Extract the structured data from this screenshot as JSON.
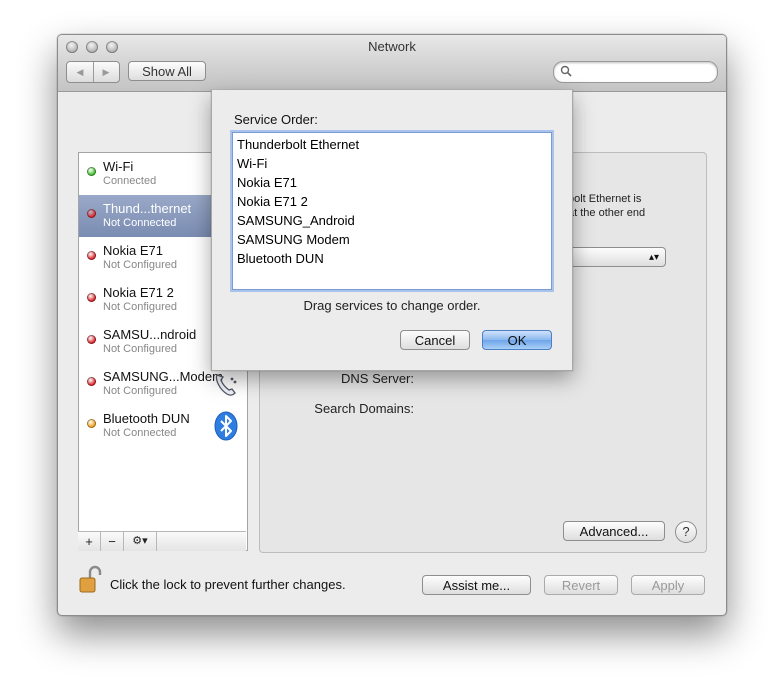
{
  "window": {
    "title": "Network"
  },
  "toolbar": {
    "back_label": "◀",
    "forward_label": "▶",
    "show_all_label": "Show All",
    "search_placeholder": ""
  },
  "services": [
    {
      "name": "Wi-Fi",
      "status": "Connected",
      "status_color": "#3fbf2a",
      "icon": "wifi-icon"
    },
    {
      "name": "Thund...thernet",
      "status": "Not Connected",
      "status_color": "#d9262c",
      "icon": "ethernet-icon",
      "selected": true
    },
    {
      "name": "Nokia E71",
      "status": "Not Configured",
      "status_color": "#d9262c",
      "icon": "phone-icon"
    },
    {
      "name": "Nokia E71 2",
      "status": "Not Configured",
      "status_color": "#d9262c",
      "icon": "phone-icon"
    },
    {
      "name": "SAMSU...ndroid",
      "status": "Not Configured",
      "status_color": "#d9262c",
      "icon": "phone-icon"
    },
    {
      "name": "SAMSUNG...Modem",
      "status": "Not Configured",
      "status_color": "#d9262c",
      "icon": "telephone-icon"
    },
    {
      "name": "Bluetooth DUN",
      "status": "Not Connected",
      "status_color": "#f0a01c",
      "icon": "bluetooth-icon"
    }
  ],
  "sidebar_controls": {
    "add_label": "+",
    "remove_label": "−",
    "action_label": "⚙▾"
  },
  "detail": {
    "status_text_line1": "bolt Ethernet is",
    "status_text_line2": "at the other end",
    "dns_label": "DNS Server:",
    "search_domains_label": "Search Domains:",
    "advanced_label": "Advanced...",
    "help_label": "?"
  },
  "sheet": {
    "title": "Service Order:",
    "items": [
      "Thunderbolt Ethernet",
      "Wi-Fi",
      "Nokia E71",
      "Nokia E71 2",
      "SAMSUNG_Android",
      "SAMSUNG Modem",
      "Bluetooth DUN"
    ],
    "hint": "Drag services to change order.",
    "cancel_label": "Cancel",
    "ok_label": "OK"
  },
  "footer": {
    "lock_text": "Click the lock to prevent further changes.",
    "assist_label": "Assist me...",
    "revert_label": "Revert",
    "apply_label": "Apply"
  },
  "colors": {
    "accent": "#6ea4e9",
    "selection": "#7a8cb2"
  }
}
